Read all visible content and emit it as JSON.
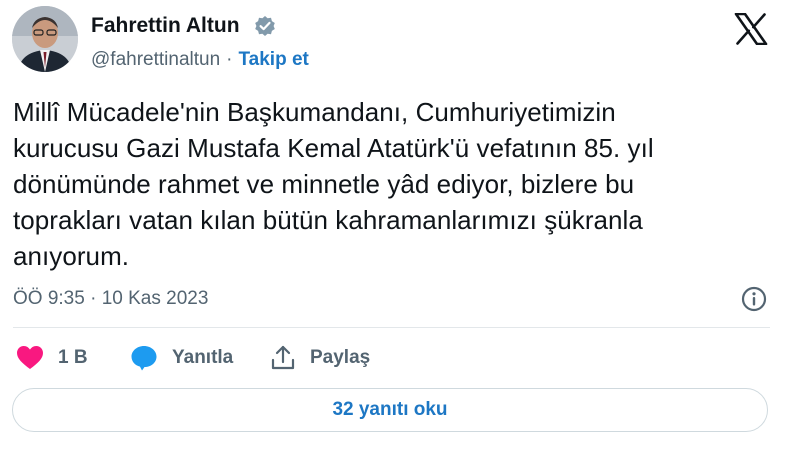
{
  "author": {
    "name": "Fahrettin Altun",
    "handle": "@fahrettinaltun",
    "separator": "·",
    "follow_label": "Takip et"
  },
  "tweet": {
    "text": "Millî Mücadele'nin Başkumandanı, Cumhuriyetimizin\nkurucusu Gazi Mustafa Kemal Atatürk'ü vefatının 85. yıl\ndönümünde rahmet ve minnetle yâd ediyor, bizlere bu\ntoprakları vatan kılan bütün kahramanlarımızı şükranla\nanıyorum.",
    "timestamp": "ÖÖ 9:35 · 10 Kas 2023"
  },
  "actions": {
    "like_count": "1 B",
    "reply_label": "Yanıtla",
    "share_label": "Paylaş"
  },
  "replies_button_label": "32 yanıtı oku",
  "icons": {
    "verified": "verified-badge-icon",
    "platform": "x-logo-icon",
    "info": "info-icon",
    "like": "heart-icon",
    "reply": "speech-bubble-icon",
    "share": "share-icon"
  },
  "colors": {
    "accent": "#1d77c4",
    "like": "#f91880",
    "reply": "#1d9bf0",
    "secondary_text": "#536471",
    "verified_badge": "#829aab"
  }
}
